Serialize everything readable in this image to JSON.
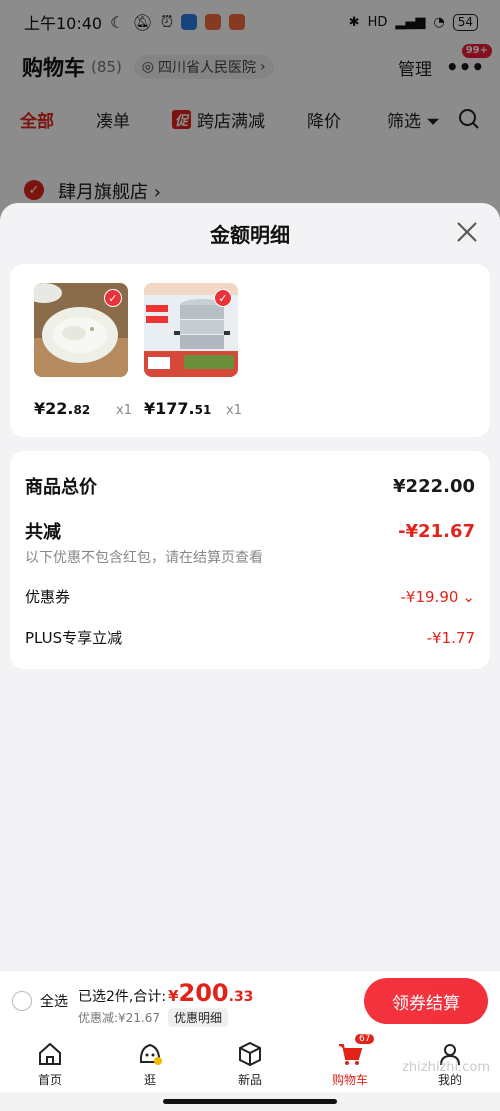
{
  "status_bar": {
    "time": "上午10:40",
    "signal": "HD",
    "battery": "54"
  },
  "header": {
    "title": "购物车",
    "count": "(85)",
    "location": "四川省人民医院",
    "manage": "管理",
    "more_badge": "99+"
  },
  "filter_tabs": {
    "all": "全部",
    "bundle": "凑单",
    "promo_icon": "促",
    "promo": "跨店满减",
    "price_drop": "降价",
    "filter": "筛选"
  },
  "shop": {
    "name": "肆月旗舰店 ›"
  },
  "sheet": {
    "title": "金额明细",
    "products": [
      {
        "price_main": "¥22.",
        "price_dec": "82",
        "qty": "x1"
      },
      {
        "price_main": "¥177.",
        "price_dec": "51",
        "qty": "x1"
      }
    ],
    "total_label": "商品总价",
    "total_value": "¥222.00",
    "discount_label": "共减",
    "discount_value": "-¥21.67",
    "discount_note": "以下优惠不包含红包，请在结算页查看",
    "coupon_label": "优惠券",
    "coupon_value": "-¥19.90",
    "plus_label": "PLUS专享立减",
    "plus_value": "-¥1.77"
  },
  "checkout": {
    "select_all": "全选",
    "selected_text": "已选2件,合计:",
    "currency": "¥",
    "amount_int": "200",
    "amount_dec": ".33",
    "discount_text": "优惠减:¥21.67",
    "detail_tag": "优惠明细",
    "checkout_button": "领券结算"
  },
  "nav": {
    "home": "首页",
    "browse": "逛",
    "new": "新品",
    "cart": "购物车",
    "cart_badge": "67",
    "mine": "我的"
  },
  "watermark": "zhizhizhi.com",
  "colors": {
    "accent": "#e2231a",
    "sheet_bg": "#f3f3f5"
  }
}
